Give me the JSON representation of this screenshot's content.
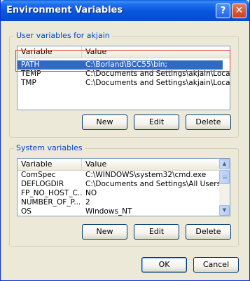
{
  "window": {
    "title": "Environment Variables",
    "help_glyph": "?",
    "close_glyph": "✕"
  },
  "user_vars": {
    "group_label": "User variables for akjain",
    "columns": [
      "Variable",
      "Value"
    ],
    "rows": [
      {
        "variable": "PATH",
        "value": "C:\\Borland\\BCC55\\bin;",
        "selected": true
      },
      {
        "variable": "TEMP",
        "value": "C:\\Documents and Settings\\akjain\\Local..."
      },
      {
        "variable": "TMP",
        "value": "C:\\Documents and Settings\\akjain\\Local..."
      }
    ],
    "buttons": {
      "new": "New",
      "edit": "Edit",
      "delete": "Delete"
    }
  },
  "system_vars": {
    "group_label": "System variables",
    "columns": [
      "Variable",
      "Value"
    ],
    "rows": [
      {
        "variable": "ComSpec",
        "value": "C:\\WINDOWS\\system32\\cmd.exe"
      },
      {
        "variable": "DEFLOGDIR",
        "value": "C:\\Documents and Settings\\All Users\\A..."
      },
      {
        "variable": "FP_NO_HOST_C...",
        "value": "NO"
      },
      {
        "variable": "NUMBER_OF_P...",
        "value": "2"
      },
      {
        "variable": "OS",
        "value": "Windows_NT"
      }
    ],
    "buttons": {
      "new": "New",
      "edit": "Edit",
      "delete": "Delete"
    }
  },
  "dialog_buttons": {
    "ok": "OK",
    "cancel": "Cancel"
  },
  "colors": {
    "titlebar": "#0855dd",
    "selection": "#316ac5",
    "group_label": "#0046d5",
    "highlight_box": "#e0403a"
  },
  "icons": {
    "scroll_up": "▲",
    "scroll_down": "▼"
  }
}
